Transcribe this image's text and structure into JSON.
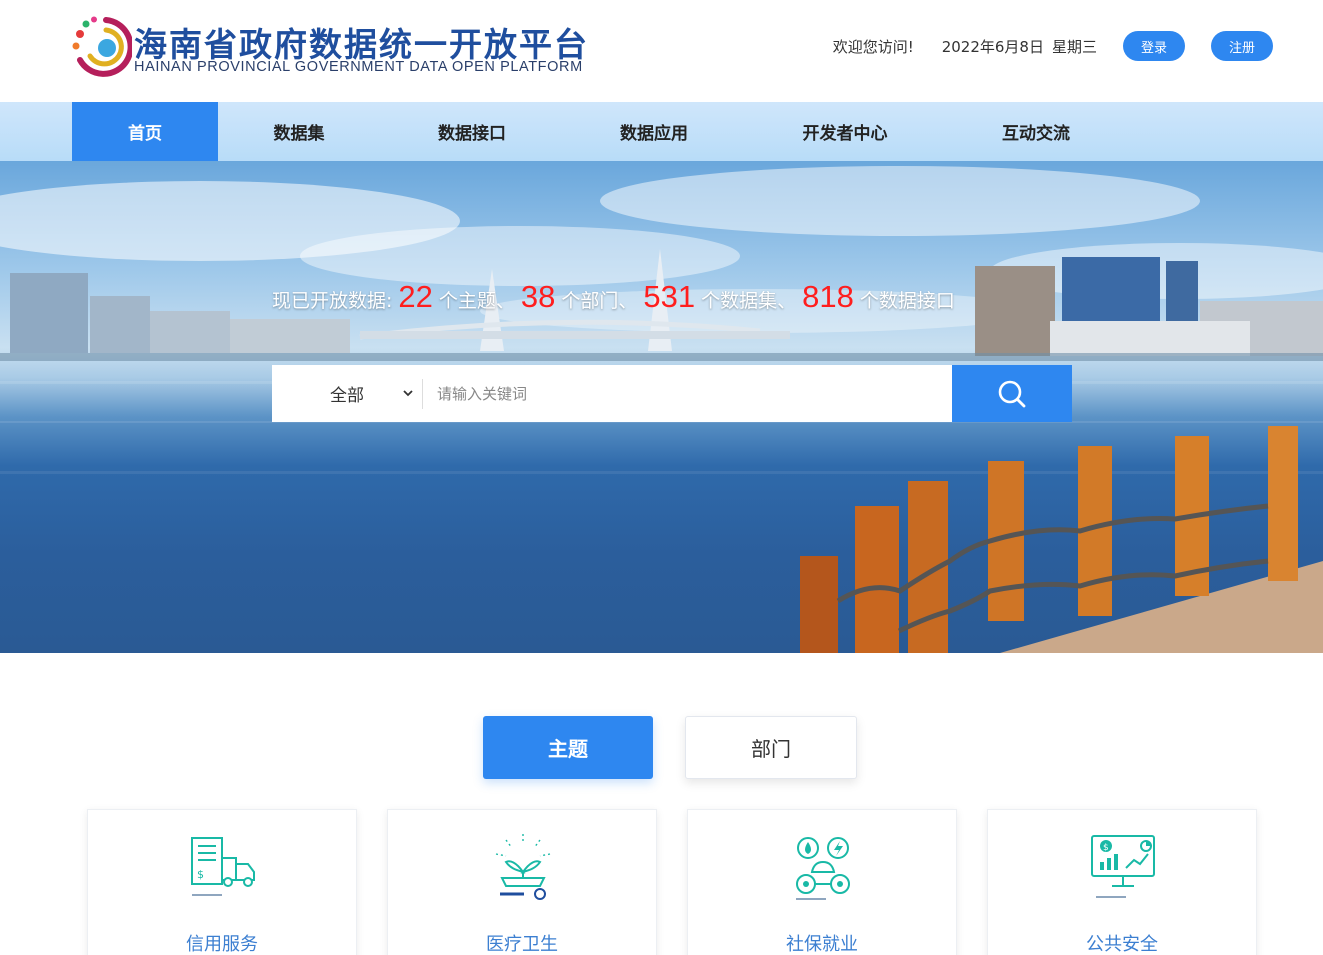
{
  "header": {
    "logo_cn": "海南省政府数据统一开放平台",
    "logo_en": "HAINAN PROVINCIAL GOVERNMENT DATA OPEN PLATFORM",
    "welcome": "欢迎您访问!",
    "date": "2022年6月8日",
    "weekday": "星期三",
    "login_label": "登录",
    "register_label": "注册"
  },
  "nav": {
    "items": [
      {
        "label": "首页",
        "active": true
      },
      {
        "label": "数据集",
        "active": false
      },
      {
        "label": "数据接口",
        "active": false
      },
      {
        "label": "数据应用",
        "active": false
      },
      {
        "label": "开发者中心",
        "active": false
      },
      {
        "label": "互动交流",
        "active": false
      }
    ]
  },
  "hero": {
    "stats": {
      "prefix": "现已开放数据:",
      "topics_count": "22",
      "topics_label": "个主题、",
      "departments_count": "38",
      "departments_label": "个部门、",
      "datasets_count": "531",
      "datasets_label": "个数据集、",
      "apis_count": "818",
      "apis_label": "个数据接口"
    },
    "search": {
      "category_selected": "全部",
      "placeholder": "请输入关键词"
    }
  },
  "tabs": {
    "topic": "主题",
    "department": "部门"
  },
  "topics": [
    {
      "label": "信用服务",
      "icon": "credit-truck-icon"
    },
    {
      "label": "医疗卫生",
      "icon": "medical-plant-icon"
    },
    {
      "label": "社保就业",
      "icon": "social-security-icon"
    },
    {
      "label": "公共安全",
      "icon": "monitor-chart-icon"
    }
  ],
  "colors": {
    "primary": "#2e87f0",
    "stat_number": "#ff1e1e",
    "logo_blue": "#1f4e9e",
    "card_label": "#3c7fd1",
    "icon_teal": "#19b9a6"
  }
}
